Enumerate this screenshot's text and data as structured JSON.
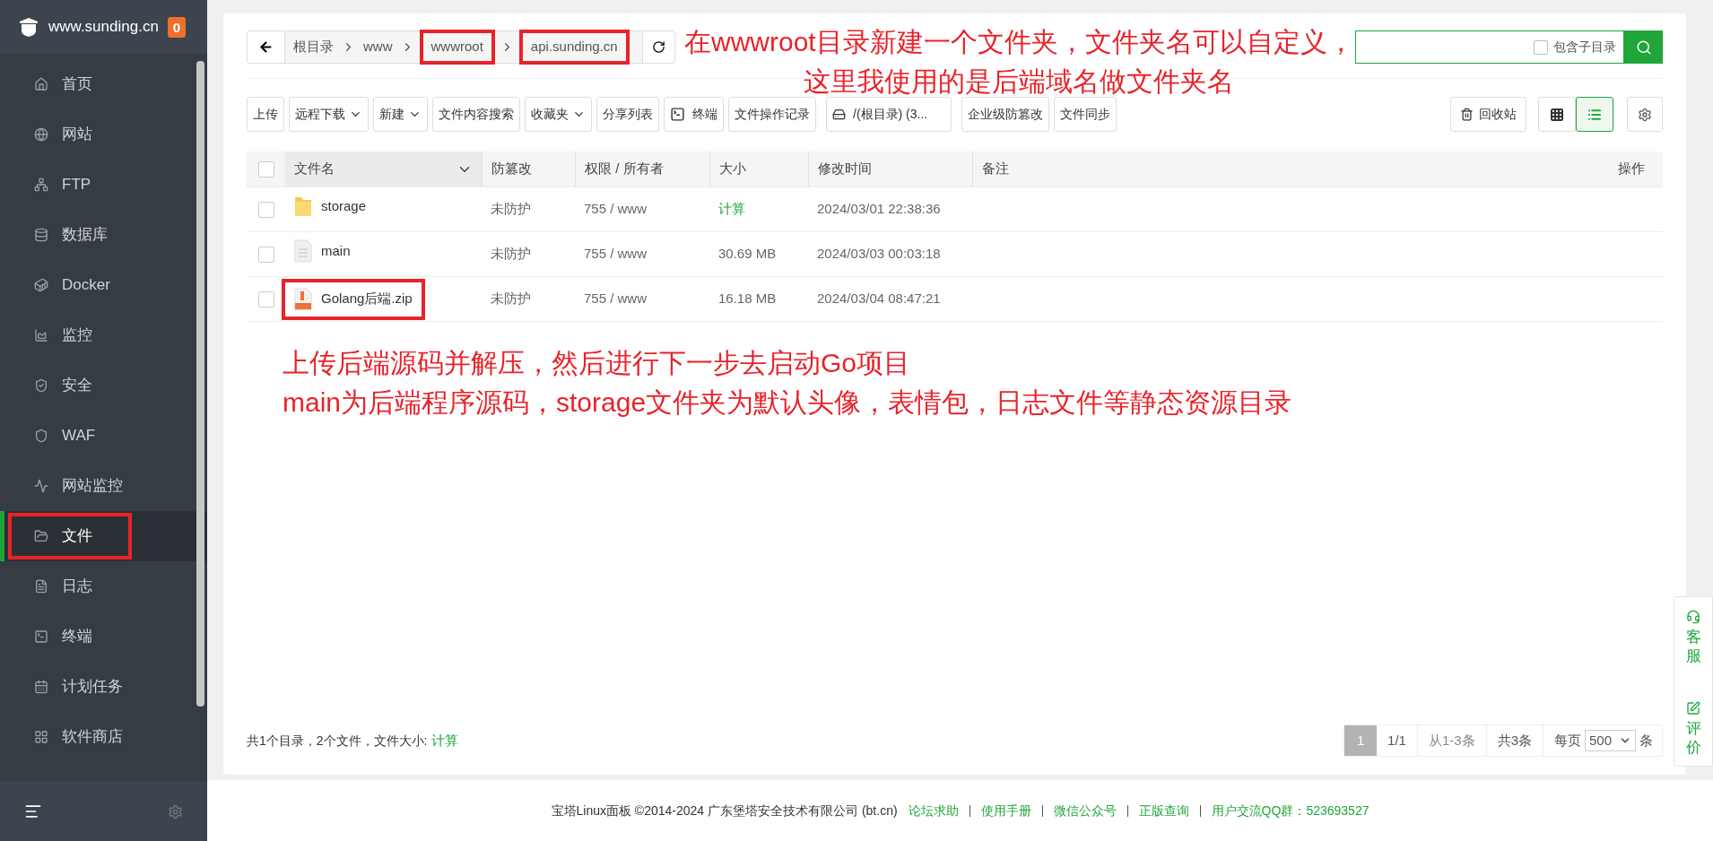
{
  "sidebar": {
    "site": "www.sunding.cn",
    "badge": "0",
    "items": [
      {
        "label": "首页",
        "selected": false,
        "highlighted": false
      },
      {
        "label": "网站",
        "selected": false,
        "highlighted": false
      },
      {
        "label": "FTP",
        "selected": false,
        "highlighted": false
      },
      {
        "label": "数据库",
        "selected": false,
        "highlighted": false
      },
      {
        "label": "Docker",
        "selected": false,
        "highlighted": false
      },
      {
        "label": "监控",
        "selected": false,
        "highlighted": false
      },
      {
        "label": "安全",
        "selected": false,
        "highlighted": false
      },
      {
        "label": "WAF",
        "selected": false,
        "highlighted": false
      },
      {
        "label": "网站监控",
        "selected": false,
        "highlighted": false
      },
      {
        "label": "文件",
        "selected": true,
        "highlighted": true
      },
      {
        "label": "日志",
        "selected": false,
        "highlighted": false
      },
      {
        "label": "终端",
        "selected": false,
        "highlighted": false
      },
      {
        "label": "计划任务",
        "selected": false,
        "highlighted": false
      },
      {
        "label": "软件商店",
        "selected": false,
        "highlighted": false
      }
    ]
  },
  "breadcrumb": [
    {
      "label": "根目录",
      "highlighted": false
    },
    {
      "label": "www",
      "highlighted": false
    },
    {
      "label": "wwwroot",
      "highlighted": true
    },
    {
      "label": "api.sunding.cn",
      "highlighted": true
    }
  ],
  "search": {
    "include_subdirs": {
      "label": "包含子目录",
      "checked": false
    }
  },
  "toolbar": [
    {
      "label": "上传",
      "kind": "plain"
    },
    {
      "label": "远程下载",
      "kind": "dropdown"
    },
    {
      "label": "新建",
      "kind": "dropdown"
    },
    {
      "label": "文件内容搜索",
      "kind": "plain"
    },
    {
      "label": "收藏夹",
      "kind": "dropdown"
    },
    {
      "label": "分享列表",
      "kind": "plain"
    },
    {
      "label": "终端",
      "kind": "terminal"
    },
    {
      "label": "文件操作记录",
      "kind": "plain"
    },
    {
      "label": "/(根目录) (3...",
      "kind": "disk"
    },
    {
      "label": "企业级防篡改",
      "kind": "plain"
    },
    {
      "label": "文件同步",
      "kind": "plain"
    }
  ],
  "recycle_bin": "回收站",
  "views": [
    {
      "kind": "grid",
      "selected": false
    },
    {
      "kind": "list",
      "selected": true
    }
  ],
  "table": {
    "select_all_checked": false,
    "columns": [
      "文件名",
      "防篡改",
      "权限 / 所有者",
      "大小",
      "修改时间",
      "备注",
      "操作"
    ],
    "rows": [
      {
        "kind": "folder",
        "name": "storage",
        "protection": "未防护",
        "permission": "755 / www",
        "size": "计算",
        "size_link": true,
        "modified": "2024/03/01 22:38:36",
        "checked": false,
        "highlighted": false
      },
      {
        "kind": "file",
        "name": "main",
        "protection": "未防护",
        "permission": "755 / www",
        "size": "30.69 MB",
        "size_link": false,
        "modified": "2024/03/03 00:03:18",
        "checked": false,
        "highlighted": false
      },
      {
        "kind": "zip",
        "name": "Golang后端.zip",
        "protection": "未防护",
        "permission": "755 / www",
        "size": "16.18 MB",
        "size_link": false,
        "modified": "2024/03/04 08:47:21",
        "checked": false,
        "highlighted": true
      }
    ]
  },
  "summary": {
    "text": "共1个目录，2个文件，文件大小:",
    "link": "计算"
  },
  "pagination": {
    "pages": [
      {
        "label": "1",
        "selected": true
      }
    ],
    "page_info": "1/1",
    "range": "从1-3条",
    "total": "共3条",
    "per_page_label": "每页",
    "per_page": "500",
    "per_page_unit": "条"
  },
  "floating": [
    {
      "kind": "service",
      "label": "客服"
    },
    {
      "kind": "review",
      "label": "评价"
    }
  ],
  "footer": {
    "copyright": "宝塔Linux面板 ©2014-2024 广东堡塔安全技术有限公司 (bt.cn)",
    "links": [
      "论坛求助",
      "使用手册",
      "微信公众号",
      "正版查询",
      "用户交流QQ群：523693527"
    ]
  },
  "annotations": [
    {
      "lines": [
        "在wwwroot目录新建一个文件夹，文件夹名可以自定义，",
        "这里我使用的是后端域名做文件夹名"
      ]
    },
    {
      "lines": [
        "上传后端源码并解压，然后进行下一步去启动Go项目",
        "main为后端程序源码，storage文件夹为默认头像，表情包，日志文件等静态资源目录"
      ]
    }
  ]
}
